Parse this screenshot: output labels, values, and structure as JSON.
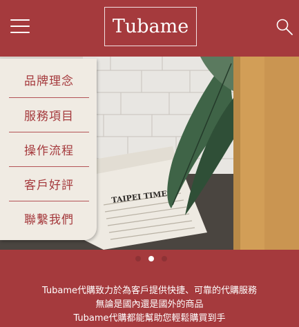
{
  "header": {
    "logo_text": "Tubame",
    "menu_icon": "hamburger-icon",
    "search_icon": "search-icon"
  },
  "colors": {
    "brand": "#a53a3d",
    "menu_background": "#f0ebe3",
    "menu_text": "#a53a3d",
    "text_light": "#ffffff"
  },
  "menu": {
    "items": [
      {
        "label": "品牌理念"
      },
      {
        "label": "服務項目"
      },
      {
        "label": "操作流程"
      },
      {
        "label": "客戶好評"
      },
      {
        "label": "聯繫我們"
      }
    ]
  },
  "slider": {
    "slide_count": 3,
    "active_index": 1,
    "newspaper_text": "TAIPEI TIMES"
  },
  "tagline": {
    "lines": [
      "Tubame代購致力於為客戶提供快捷、可靠的代購服務",
      "無論是國內還是國外的商品",
      "Tubame代購都能幫助您輕鬆購買到手"
    ]
  }
}
